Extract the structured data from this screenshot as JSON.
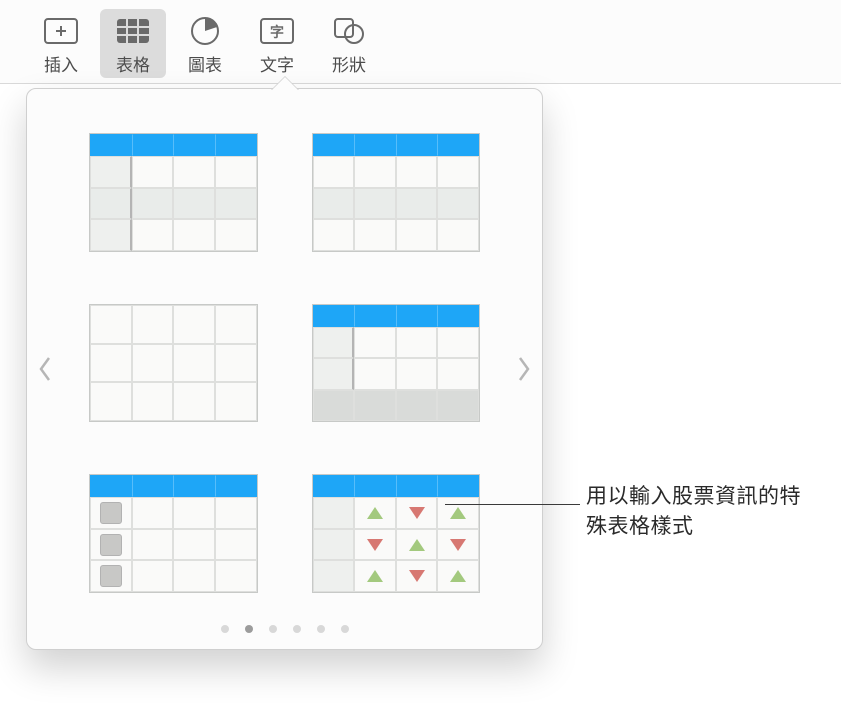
{
  "toolbar": {
    "insert": {
      "label": "插入"
    },
    "table": {
      "label": "表格"
    },
    "chart": {
      "label": "圖表"
    },
    "text": {
      "label": "文字"
    },
    "shape": {
      "label": "形狀"
    }
  },
  "popover": {
    "page_dots": {
      "count": 6,
      "active_index": 1
    }
  },
  "callout": {
    "text": "用以輸入股票資訊的特殊表格樣式"
  }
}
